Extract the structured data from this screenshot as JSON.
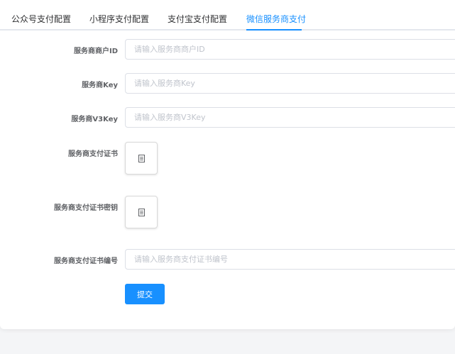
{
  "tabs": [
    {
      "label": "公众号支付配置",
      "active": false
    },
    {
      "label": "小程序支付配置",
      "active": false
    },
    {
      "label": "支付宝支付配置",
      "active": false
    },
    {
      "label": "微信服务商支付",
      "active": true
    }
  ],
  "form": {
    "merchant_id": {
      "label": "服务商商户ID",
      "value": "",
      "placeholder": "请输入服务商商户ID"
    },
    "key": {
      "label": "服务商Key",
      "value": "",
      "placeholder": "请输入服务商Key"
    },
    "v3key": {
      "label": "服务商V3Key",
      "value": "",
      "placeholder": "请输入服务商V3Key"
    },
    "cert": {
      "label": "服务商支付证书",
      "icon": "document-icon"
    },
    "cert_key": {
      "label": "服务商支付证书密钥",
      "icon": "document-icon"
    },
    "cert_serial": {
      "label": "服务商支付证书编号",
      "value": "",
      "placeholder": "请输入服务商支付证书编号"
    },
    "submit_label": "提交"
  },
  "colors": {
    "accent": "#1890ff",
    "border": "#dcdfe6",
    "placeholder": "#c0c4cc",
    "label": "#606266"
  }
}
